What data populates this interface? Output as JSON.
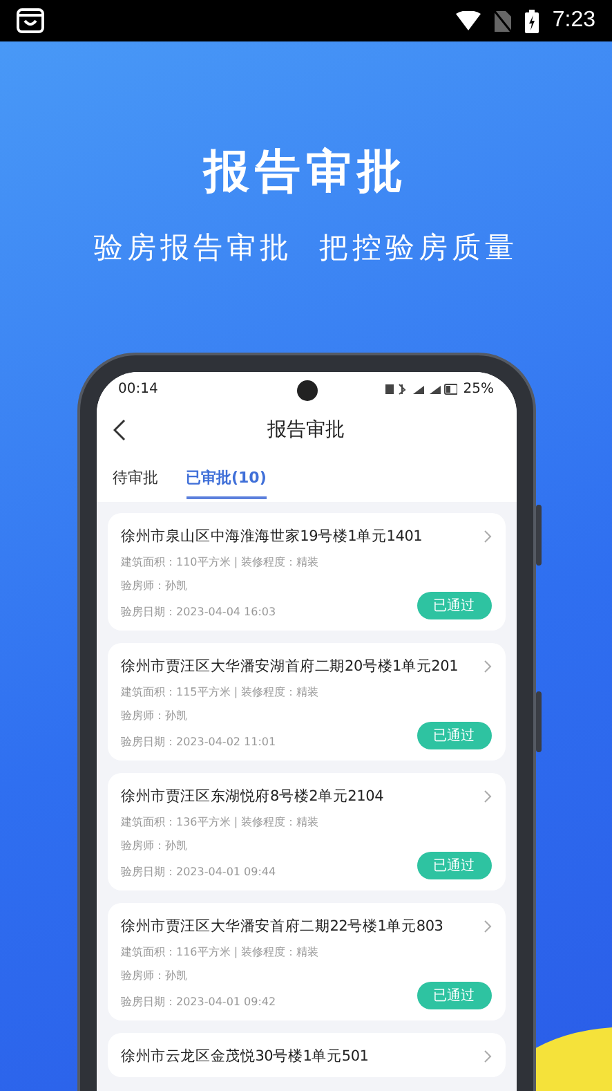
{
  "status_bar": {
    "time": "7:23"
  },
  "hero": {
    "title": "报告审批",
    "subtitle": "验房报告审批  把控验房质量"
  },
  "phone": {
    "status_bar": {
      "time": "00:14",
      "battery": "25%"
    },
    "header": {
      "title": "报告审批"
    },
    "tabs": [
      {
        "label": "待审批",
        "selected": false
      },
      {
        "label": "已审批(10)",
        "selected": true
      }
    ],
    "reports": [
      {
        "title": "徐州市泉山区中海淮海世家19号楼1单元1401",
        "details": "建筑面积：110平方米 | 装修程度：精装",
        "inspector": "验房师：孙凯",
        "date": "验房日期：2023-04-04 16:03",
        "status": "已通过"
      },
      {
        "title": "徐州市贾汪区大华潘安湖首府二期20号楼1单元201",
        "details": "建筑面积：115平方米 | 装修程度：精装",
        "inspector": "验房师：孙凯",
        "date": "验房日期：2023-04-02 11:01",
        "status": "已通过"
      },
      {
        "title": "徐州市贾汪区东湖悦府8号楼2单元2104",
        "details": "建筑面积：136平方米 | 装修程度：精装",
        "inspector": "验房师：孙凯",
        "date": "验房日期：2023-04-01 09:44",
        "status": "已通过"
      },
      {
        "title": "徐州市贾汪区大华潘安首府二期22号楼1单元803",
        "details": "建筑面积：116平方米 | 装修程度：精装",
        "inspector": "验房师：孙凯",
        "date": "验房日期：2023-04-01 09:42",
        "status": "已通过"
      },
      {
        "title": "徐州市云龙区金茂悦30号楼1单元501"
      }
    ]
  }
}
